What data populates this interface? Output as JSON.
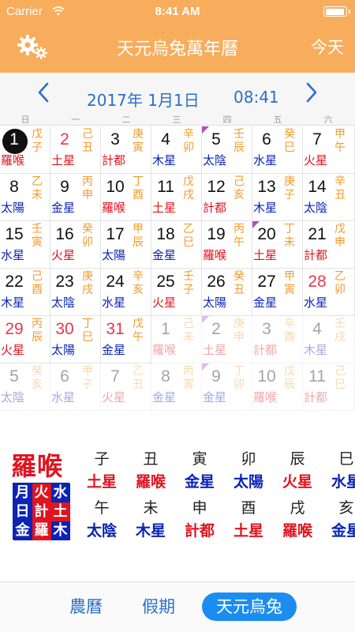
{
  "status_bar": {
    "carrier": "Carrier",
    "time": "8:41 AM"
  },
  "header": {
    "title": "天元烏兔萬年曆",
    "today_label": "今天",
    "settings_icon": "gear-icon"
  },
  "nav": {
    "date": "2017年 1月1日",
    "time": "08:41"
  },
  "weekdays": [
    "日",
    "一",
    "二",
    "三",
    "四",
    "五",
    "六"
  ],
  "colors": {
    "header_bg": "#f7ad5c",
    "accent_blue": "#2a6fc9",
    "red": "#e0141f",
    "navy": "#0b23b6",
    "ganzhi_orange": "#f39b2a",
    "holiday_red": "#e6384f",
    "flag_purple": "#b04cc8"
  },
  "calendar": [
    [
      {
        "d": "1",
        "gz": "戊子",
        "s": "羅喉",
        "c": "red",
        "today": true
      },
      {
        "d": "2",
        "gz": "己丑",
        "s": "土星",
        "c": "red",
        "hol": true
      },
      {
        "d": "3",
        "gz": "庚寅",
        "s": "計都",
        "c": "red"
      },
      {
        "d": "4",
        "gz": "辛卯",
        "s": "木星",
        "c": "navy"
      },
      {
        "d": "5",
        "gz": "壬辰",
        "s": "太陰",
        "c": "navy",
        "flag": true
      },
      {
        "d": "6",
        "gz": "癸巳",
        "s": "水星",
        "c": "navy"
      },
      {
        "d": "7",
        "gz": "甲午",
        "s": "火星",
        "c": "red"
      }
    ],
    [
      {
        "d": "8",
        "gz": "乙未",
        "s": "太陽",
        "c": "navy"
      },
      {
        "d": "9",
        "gz": "丙申",
        "s": "金星",
        "c": "navy"
      },
      {
        "d": "10",
        "gz": "丁酉",
        "s": "羅喉",
        "c": "red"
      },
      {
        "d": "11",
        "gz": "戊戌",
        "s": "土星",
        "c": "red"
      },
      {
        "d": "12",
        "gz": "己亥",
        "s": "計都",
        "c": "red"
      },
      {
        "d": "13",
        "gz": "庚子",
        "s": "木星",
        "c": "navy"
      },
      {
        "d": "14",
        "gz": "辛丑",
        "s": "太陰",
        "c": "navy"
      }
    ],
    [
      {
        "d": "15",
        "gz": "壬寅",
        "s": "水星",
        "c": "navy"
      },
      {
        "d": "16",
        "gz": "癸卯",
        "s": "火星",
        "c": "red"
      },
      {
        "d": "17",
        "gz": "甲辰",
        "s": "太陽",
        "c": "navy"
      },
      {
        "d": "18",
        "gz": "乙巳",
        "s": "金星",
        "c": "navy"
      },
      {
        "d": "19",
        "gz": "丙午",
        "s": "羅喉",
        "c": "red"
      },
      {
        "d": "20",
        "gz": "丁未",
        "s": "土星",
        "c": "red",
        "flag": true
      },
      {
        "d": "21",
        "gz": "戊申",
        "s": "計都",
        "c": "red"
      }
    ],
    [
      {
        "d": "22",
        "gz": "己酉",
        "s": "木星",
        "c": "navy"
      },
      {
        "d": "23",
        "gz": "庚戌",
        "s": "太陰",
        "c": "navy"
      },
      {
        "d": "24",
        "gz": "辛亥",
        "s": "水星",
        "c": "navy"
      },
      {
        "d": "25",
        "gz": "壬子",
        "s": "火星",
        "c": "red"
      },
      {
        "d": "26",
        "gz": "癸丑",
        "s": "太陽",
        "c": "navy"
      },
      {
        "d": "27",
        "gz": "甲寅",
        "s": "金星",
        "c": "navy"
      },
      {
        "d": "28",
        "gz": "乙卯",
        "s": "水星",
        "c": "navy",
        "hol": true
      }
    ],
    [
      {
        "d": "29",
        "gz": "丙辰",
        "s": "火星",
        "c": "red",
        "hol": true
      },
      {
        "d": "30",
        "gz": "丁巳",
        "s": "太陽",
        "c": "navy",
        "hol": true
      },
      {
        "d": "31",
        "gz": "戊午",
        "s": "金星",
        "c": "navy",
        "hol": true
      },
      {
        "d": "1",
        "gz": "己未",
        "s": "羅喉",
        "c": "red",
        "other": true
      },
      {
        "d": "2",
        "gz": "庚申",
        "s": "土星",
        "c": "red",
        "other": true,
        "flag": true
      },
      {
        "d": "3",
        "gz": "辛酉",
        "s": "計都",
        "c": "red",
        "other": true
      },
      {
        "d": "4",
        "gz": "壬戌",
        "s": "木星",
        "c": "navy",
        "other": true
      }
    ],
    [
      {
        "d": "5",
        "gz": "癸亥",
        "s": "太陰",
        "c": "navy",
        "other": true
      },
      {
        "d": "6",
        "gz": "甲子",
        "s": "水星",
        "c": "navy",
        "other": true
      },
      {
        "d": "7",
        "gz": "乙丑",
        "s": "火星",
        "c": "red",
        "other": true
      },
      {
        "d": "8",
        "gz": "丙寅",
        "s": "金星",
        "c": "navy",
        "other": true
      },
      {
        "d": "9",
        "gz": "丁卯",
        "s": "金星",
        "c": "navy",
        "other": true,
        "flag": true
      },
      {
        "d": "10",
        "gz": "戊辰",
        "s": "羅喉",
        "c": "red",
        "other": true
      },
      {
        "d": "11",
        "gz": "己巳",
        "s": "計都",
        "c": "red",
        "other": true
      }
    ]
  ],
  "detail": {
    "star": "羅喉",
    "mini_grid": [
      [
        {
          "t": "月",
          "c": "navy"
        },
        {
          "t": "火",
          "c": "red"
        },
        {
          "t": "水",
          "c": "navy"
        }
      ],
      [
        {
          "t": "日",
          "c": "navy"
        },
        {
          "t": "計",
          "c": "red"
        },
        {
          "t": "土",
          "c": "red"
        }
      ],
      [
        {
          "t": "金",
          "c": "navy"
        },
        {
          "t": "羅",
          "c": "red"
        },
        {
          "t": "木",
          "c": "navy"
        }
      ]
    ],
    "hours": [
      {
        "b": "子",
        "s": "土星",
        "c": "red"
      },
      {
        "b": "丑",
        "s": "羅喉",
        "c": "red"
      },
      {
        "b": "寅",
        "s": "金星",
        "c": "navy"
      },
      {
        "b": "卯",
        "s": "太陽",
        "c": "navy"
      },
      {
        "b": "辰",
        "s": "火星",
        "c": "red"
      },
      {
        "b": "巳",
        "s": "水星",
        "c": "navy"
      },
      {
        "b": "午",
        "s": "太陰",
        "c": "navy"
      },
      {
        "b": "未",
        "s": "木星",
        "c": "navy"
      },
      {
        "b": "申",
        "s": "計都",
        "c": "red"
      },
      {
        "b": "酉",
        "s": "土星",
        "c": "red"
      },
      {
        "b": "戌",
        "s": "羅喉",
        "c": "red"
      },
      {
        "b": "亥",
        "s": "金星",
        "c": "navy"
      }
    ]
  },
  "tabs": [
    "農曆",
    "假期",
    "天元烏兔"
  ]
}
